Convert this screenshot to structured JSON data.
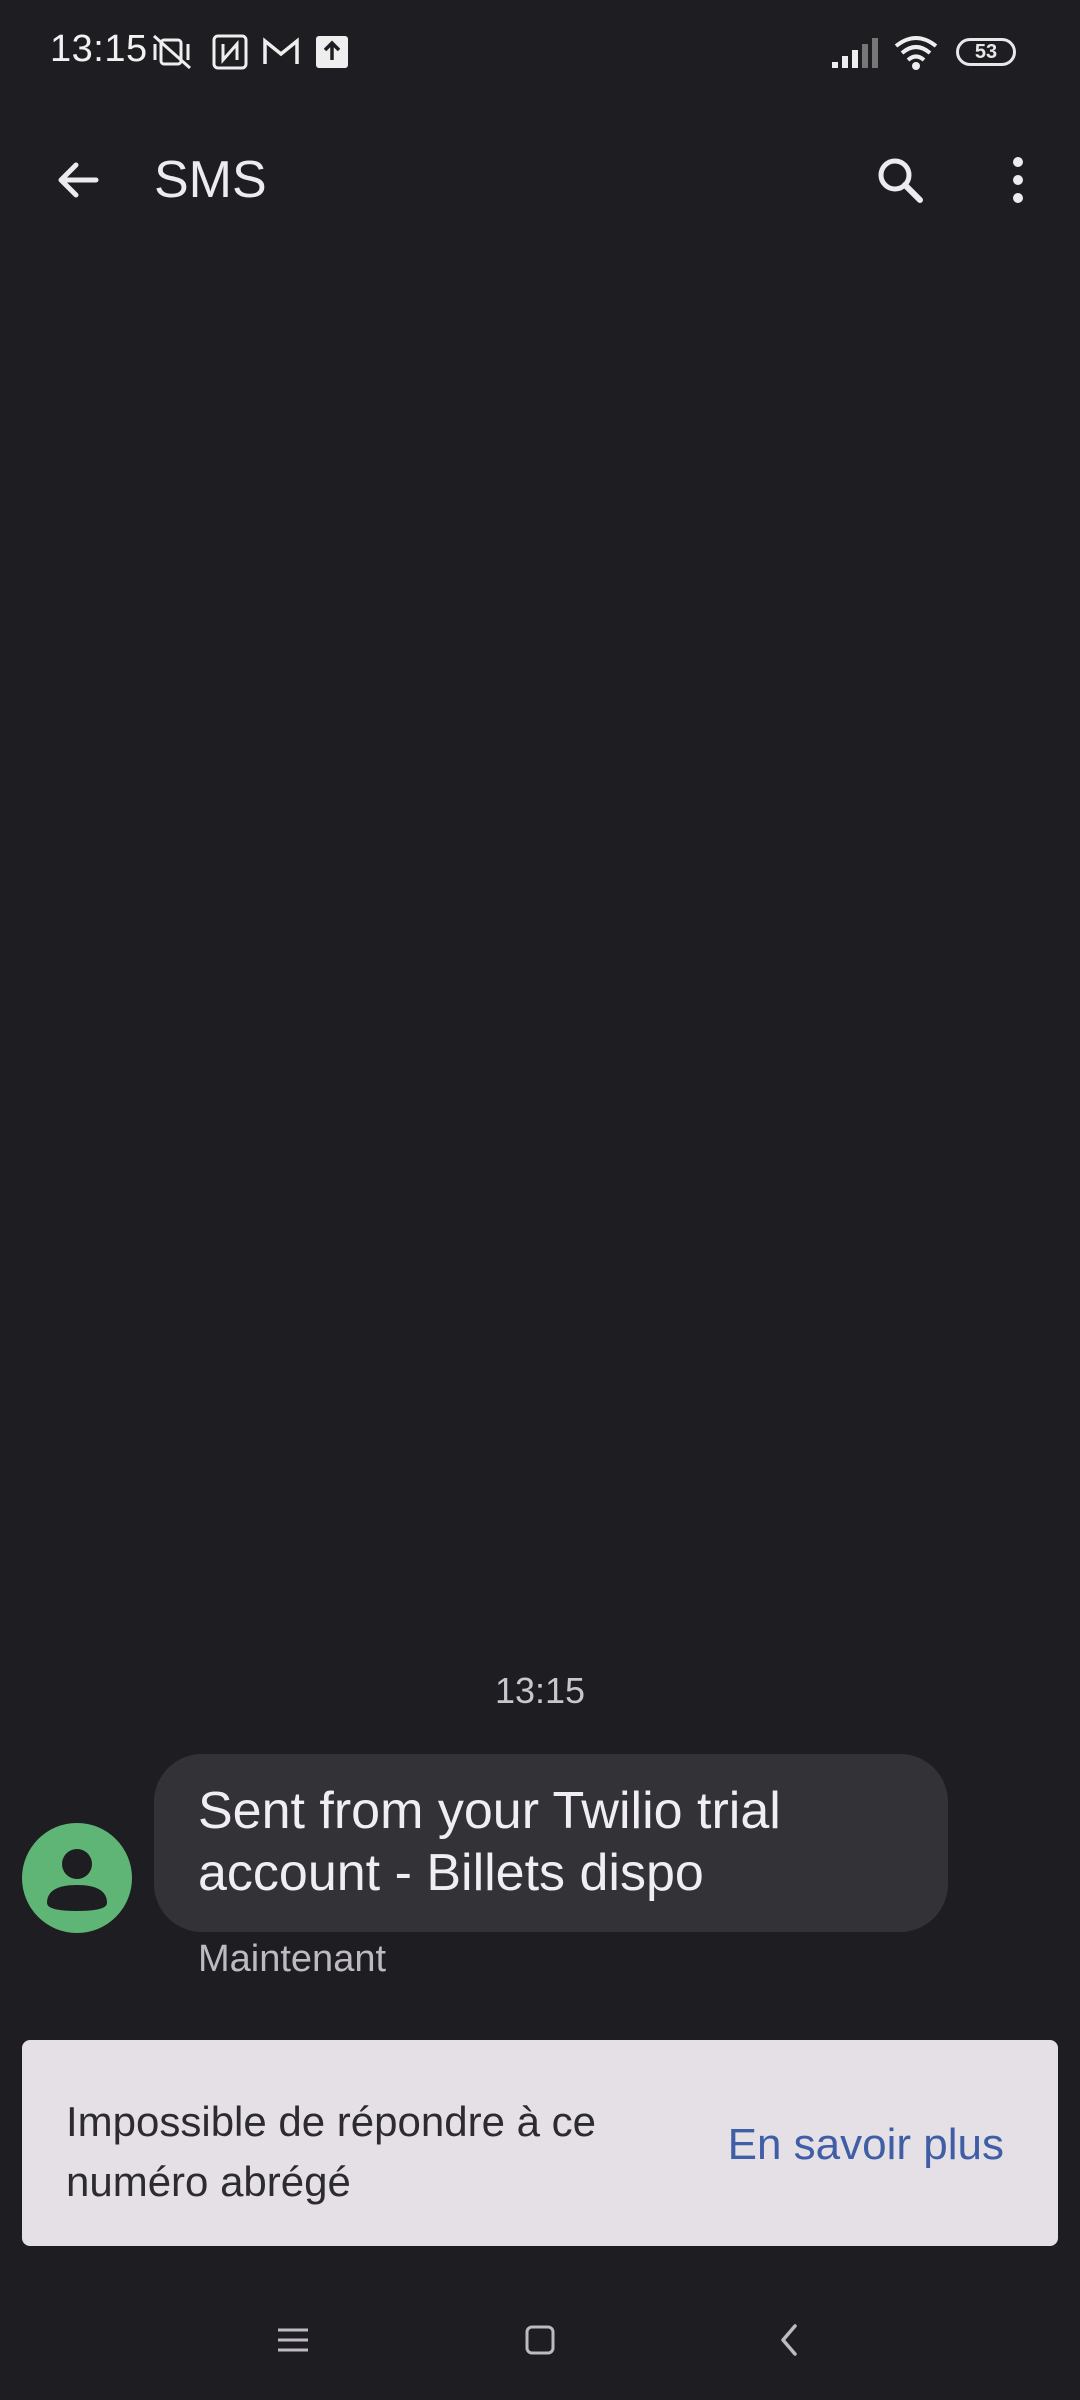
{
  "status_bar": {
    "time": "13:15",
    "battery_level": "53",
    "icons": [
      "vibrate-off-icon",
      "nfc-icon",
      "gmail-icon",
      "upload-icon",
      "signal-icon",
      "wifi-icon",
      "battery-icon"
    ]
  },
  "app_bar": {
    "title": "SMS",
    "back_icon": "arrow-back-icon",
    "search_icon": "search-icon",
    "more_icon": "more-vert-icon"
  },
  "conversation": {
    "timestamp": "13:15",
    "messages": [
      {
        "text": "Sent from your Twilio trial account - Billets dispo",
        "status": "Maintenant",
        "avatar_icon": "person-icon"
      }
    ]
  },
  "notice": {
    "text": "Impossible de répondre à ce numéro abrégé",
    "link_label": "En savoir plus"
  },
  "nav_bar": {
    "icons": [
      "recents-icon",
      "home-icon",
      "back-icon"
    ]
  },
  "colors": {
    "background": "#1e1e22",
    "bubble": "#323237",
    "avatar": "#5fb575",
    "notice_bg": "#e4e0e6",
    "link": "#3f5ea5"
  }
}
